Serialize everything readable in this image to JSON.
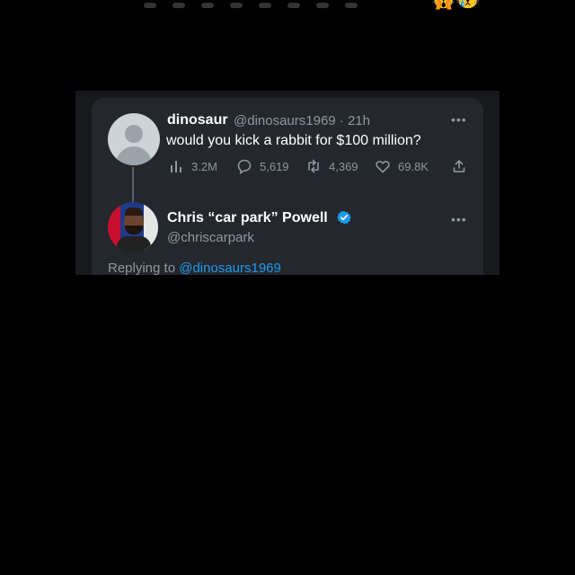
{
  "top_emoji": "🙀😿",
  "tweet": {
    "author_name": "dinosaur",
    "handle_time": "@dinosaurs1969 · 21h",
    "text": "would you kick a rabbit for $100 million?",
    "more": "•••",
    "stats": {
      "views": "3.2M",
      "replies": "5,619",
      "retweets": "4,369",
      "likes": "69.8K"
    }
  },
  "reply": {
    "author_name": "Chris “car park” Powell",
    "handle": "@chriscarpark",
    "more": "•••",
    "replying_prefix": "Replying to ",
    "replying_handle": "@dinosaurs1969"
  },
  "colors": {
    "background": "#000000",
    "card": "#24272c",
    "muted": "#8b98a5",
    "link": "#1d9bf0",
    "verified": "#1d9bf0"
  }
}
